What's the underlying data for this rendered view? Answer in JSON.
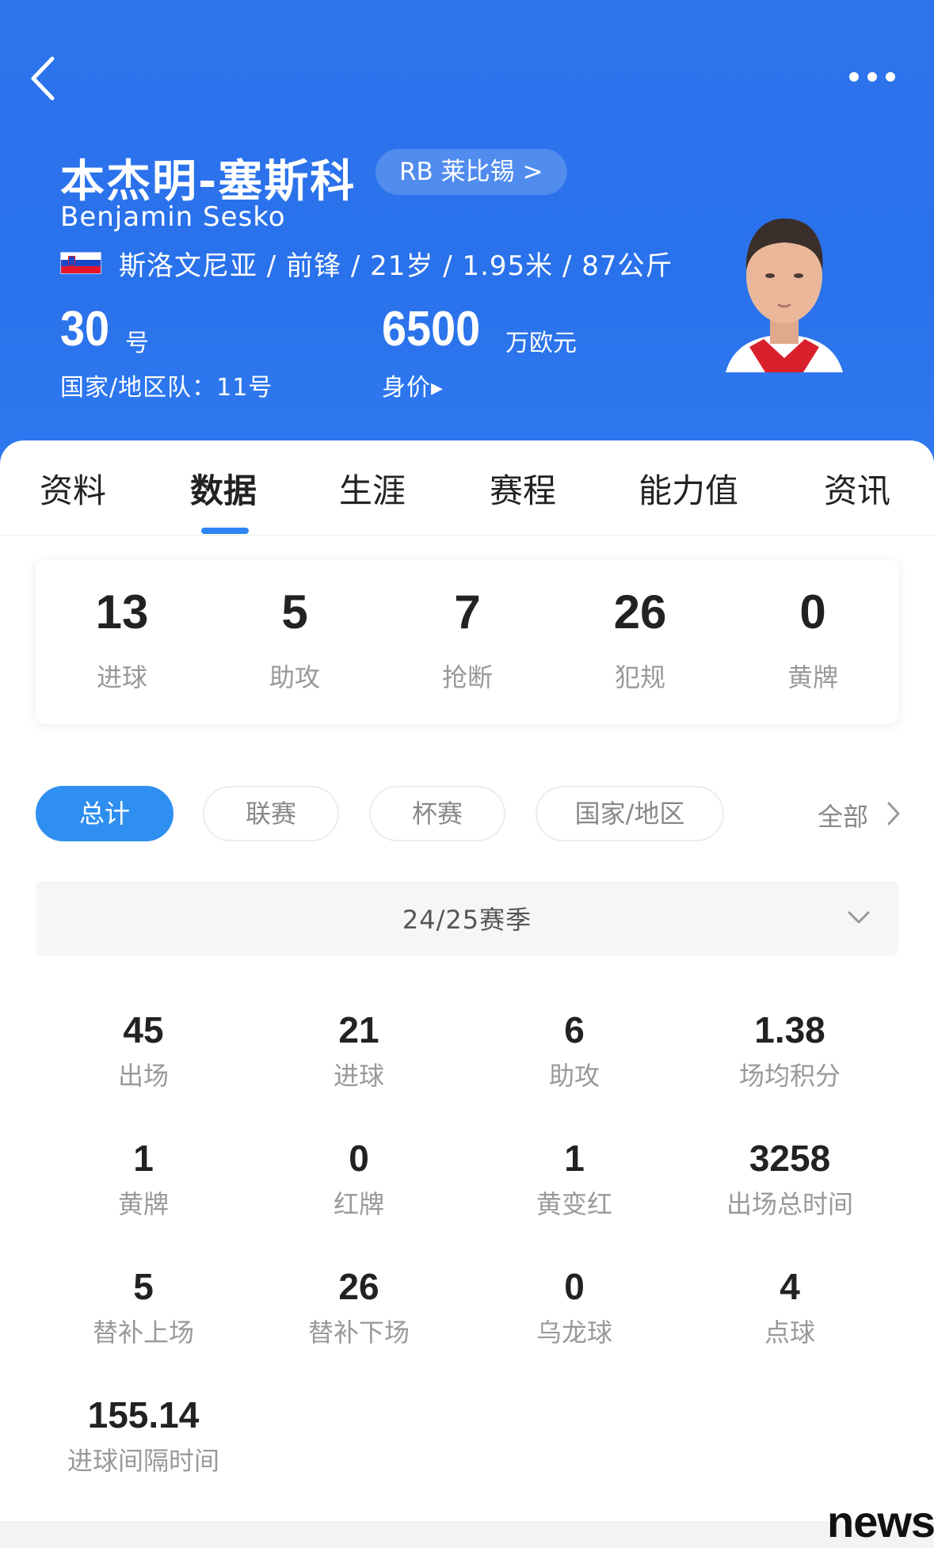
{
  "header": {
    "player_name": "本杰明-塞斯科",
    "team_chip": "RB 莱比锡 >",
    "name_en": "Benjamin Sesko",
    "meta": "斯洛文尼亚 / 前锋 / 21岁 / 1.95米 / 87公斤",
    "shirt_number": "30",
    "shirt_unit": "号",
    "national_number": "国家/地区队：11号",
    "market_value": "6500",
    "market_unit": "万欧元",
    "market_label": "身价▸",
    "flag": "slovenia-flag"
  },
  "tabs": [
    "资料",
    "数据",
    "生涯",
    "赛程",
    "能力值",
    "资讯"
  ],
  "active_tab": "数据",
  "summary": [
    {
      "value": "13",
      "label": "进球"
    },
    {
      "value": "5",
      "label": "助攻"
    },
    {
      "value": "7",
      "label": "抢断"
    },
    {
      "value": "26",
      "label": "犯规"
    },
    {
      "value": "0",
      "label": "黄牌"
    }
  ],
  "filters": {
    "chips": [
      "总计",
      "联赛",
      "杯赛",
      "国家/地区"
    ],
    "active": "总计",
    "all": "全部"
  },
  "season": "24/25赛季",
  "stats": [
    {
      "value": "45",
      "label": "出场"
    },
    {
      "value": "21",
      "label": "进球"
    },
    {
      "value": "6",
      "label": "助攻"
    },
    {
      "value": "1.38",
      "label": "场均积分"
    },
    {
      "value": "1",
      "label": "黄牌"
    },
    {
      "value": "0",
      "label": "红牌"
    },
    {
      "value": "1",
      "label": "黄变红"
    },
    {
      "value": "3258",
      "label": "出场总时间"
    },
    {
      "value": "5",
      "label": "替补上场"
    },
    {
      "value": "26",
      "label": "替补下场"
    },
    {
      "value": "0",
      "label": "乌龙球"
    },
    {
      "value": "4",
      "label": "点球"
    },
    {
      "value": "155.14",
      "label": "进球间隔时间"
    }
  ],
  "watermark": "news",
  "colors": {
    "header_blue": "#2a72eb",
    "accent": "#2f8ff1"
  },
  "icons": [
    "back-icon",
    "more-icon",
    "chevron-right-icon",
    "chevron-down-icon"
  ]
}
